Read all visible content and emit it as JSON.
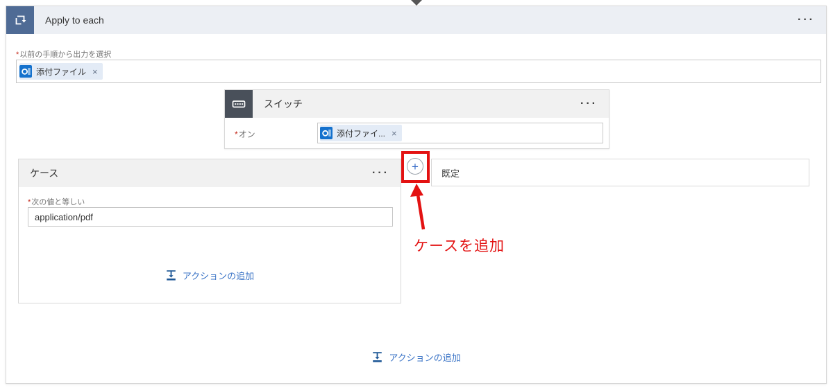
{
  "colors": {
    "annotation_red": "#e31212",
    "link_blue": "#3a73c6",
    "apply_to_each_icon_bg": "#4f6b95",
    "switch_icon_bg": "#49505a",
    "outlook_blue": "#1471cd",
    "scope_header_bg": "#eceff4",
    "card_header_bg": "#f1f1f1"
  },
  "scope": {
    "title": "Apply to each",
    "menu": "···",
    "output_label": {
      "mark": "*",
      "text": "以前の手順から出力を選択"
    },
    "token": {
      "text": "添付ファイル",
      "remove": "×"
    }
  },
  "switch_card": {
    "title": "スイッチ",
    "menu": "···",
    "on_label": {
      "mark": "*",
      "text": "オン"
    },
    "token": {
      "text": "添付ファイ...",
      "remove": "×"
    }
  },
  "case_card": {
    "title": "ケース",
    "menu": "···",
    "equals_label": {
      "mark": "*",
      "text": "次の値と等しい"
    },
    "value": "application/pdf",
    "add_action": "アクションの追加"
  },
  "default_card": {
    "title": "既定"
  },
  "add_case_button": {
    "glyph": "+"
  },
  "annotation": {
    "label": "ケースを追加"
  },
  "footer": {
    "add_action": "アクションの追加"
  }
}
